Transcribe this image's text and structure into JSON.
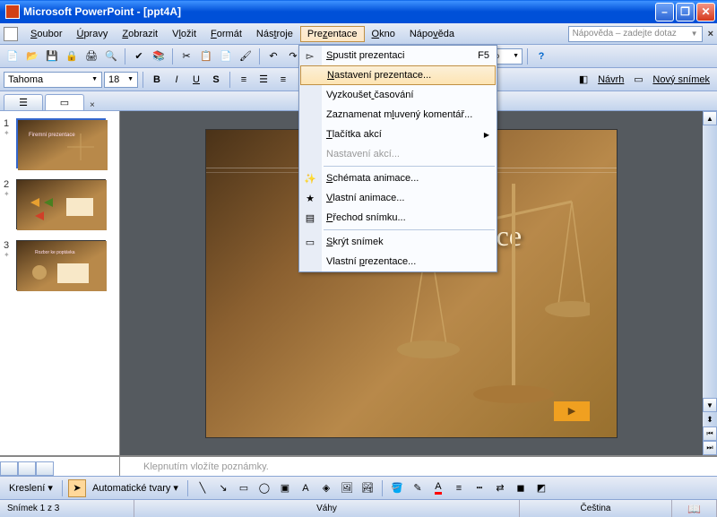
{
  "titlebar": {
    "title": "Microsoft PowerPoint - [ppt4A]"
  },
  "menu": {
    "items": [
      "Soubor",
      "Úpravy",
      "Zobrazit",
      "Vložit",
      "Formát",
      "Nástroje",
      "Prezentace",
      "Okno",
      "Nápověda"
    ],
    "underline_idx": [
      0,
      0,
      0,
      1,
      0,
      3,
      3,
      0,
      4
    ],
    "help_placeholder": "Nápověda – zadejte dotaz"
  },
  "toolbar": {
    "zoom": "50%"
  },
  "formatbar": {
    "font": "Tahoma",
    "size": "18",
    "design_label": "Návrh",
    "newslide_label": "Nový snímek"
  },
  "dropdown": {
    "items": [
      {
        "label": "Spustit prezentaci",
        "shortcut": "F5",
        "icon": "play"
      },
      {
        "label": "Nastavení prezentace...",
        "hl": true
      },
      {
        "label": "Vyzkoušet časování"
      },
      {
        "label": "Zaznamenat mluvený komentář..."
      },
      {
        "label": "Tlačítka akcí",
        "submenu": true
      },
      {
        "label": "Nastavení akcí...",
        "disabled": true
      },
      {
        "sep": true
      },
      {
        "label": "Schémata animace...",
        "icon": "anim"
      },
      {
        "label": "Vlastní animace...",
        "icon": "star"
      },
      {
        "label": "Přechod snímku...",
        "icon": "trans"
      },
      {
        "sep": true
      },
      {
        "label": "Skrýt snímek",
        "icon": "hide"
      },
      {
        "label": "Vlastní prezentace..."
      }
    ],
    "underline_map": [
      0,
      0,
      9,
      12,
      0,
      -1,
      -1,
      0,
      0,
      0,
      -1,
      0,
      8
    ]
  },
  "slide": {
    "title": "Firemní prezentace"
  },
  "thumbs": {
    "count": 3
  },
  "notes": {
    "placeholder": "Klepnutím vložíte poznámky."
  },
  "drawbar": {
    "draw_label": "Kreslení",
    "autoshapes": "Automatické tvary"
  },
  "status": {
    "slide_info": "Snímek 1 z 3",
    "design": "Váhy",
    "lang": "Čeština"
  }
}
